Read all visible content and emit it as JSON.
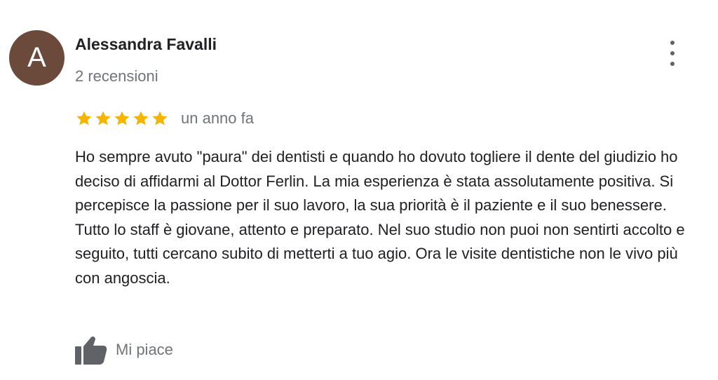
{
  "reviewer": {
    "avatar_letter": "A",
    "avatar_color": "#6b4a3c",
    "name": "Alessandra Favalli",
    "review_count": "2 recensioni"
  },
  "menu": {
    "icon": "more-vert-icon"
  },
  "review": {
    "rating": 5,
    "rating_max": 5,
    "star_color": "#f4b400",
    "date": "un anno fa",
    "text": "Ho sempre avuto \"paura\" dei dentisti e quando ho dovuto togliere il dente del giudizio ho deciso di affidarmi al Dottor Ferlin. La mia esperienza è stata assolutamente positiva. Si percepisce la passione per il suo lavoro, la sua priorità è il paziente e il suo benessere. Tutto lo staff è giovane, attento e preparato. Nel suo studio non puoi non sentirti accolto e seguito, tutti cercano subito di metterti a tuo agio. Ora le visite dentistiche non le vivo più con angoscia."
  },
  "actions": {
    "like_label": "Mi piace",
    "like_icon": "thumb-up-icon"
  }
}
